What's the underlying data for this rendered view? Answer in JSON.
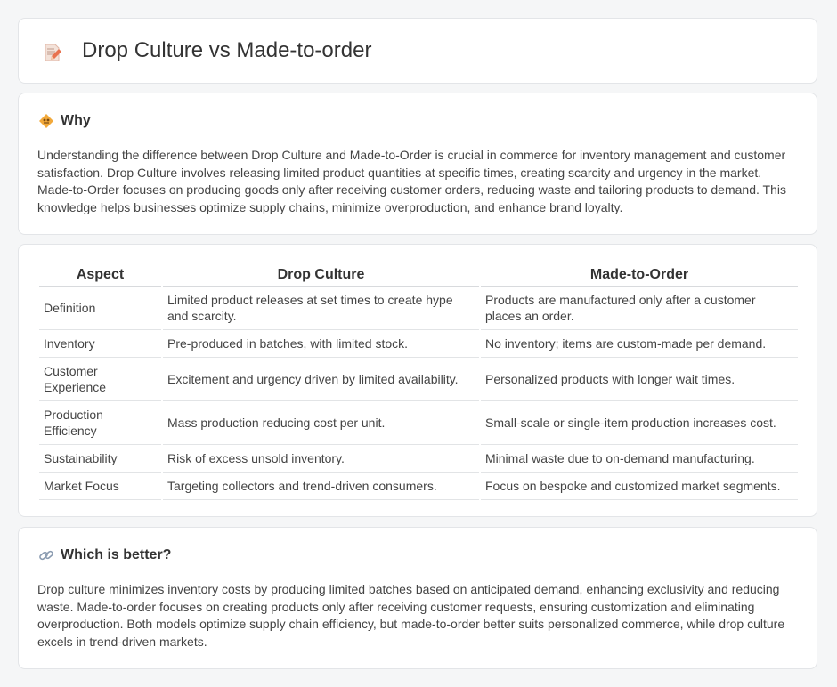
{
  "title": "Drop Culture vs Made-to-order",
  "why": {
    "heading": "Why",
    "text": "Understanding the difference between Drop Culture and Made-to-Order is crucial in commerce for inventory management and customer satisfaction. Drop Culture involves releasing limited product quantities at specific times, creating scarcity and urgency in the market. Made-to-Order focuses on producing goods only after receiving customer orders, reducing waste and tailoring products to demand. This knowledge helps businesses optimize supply chains, minimize overproduction, and enhance brand loyalty."
  },
  "table": {
    "headers": [
      "Aspect",
      "Drop Culture",
      "Made-to-Order"
    ],
    "rows": [
      [
        "Definition",
        "Limited product releases at set times to create hype and scarcity.",
        "Products are manufactured only after a customer places an order."
      ],
      [
        "Inventory",
        "Pre-produced in batches, with limited stock.",
        "No inventory; items are custom-made per demand."
      ],
      [
        "Customer Experience",
        "Excitement and urgency driven by limited availability.",
        "Personalized products with longer wait times."
      ],
      [
        "Production Efficiency",
        "Mass production reducing cost per unit.",
        "Small-scale or single-item production increases cost."
      ],
      [
        "Sustainability",
        "Risk of excess unsold inventory.",
        "Minimal waste due to on-demand manufacturing."
      ],
      [
        "Market Focus",
        "Targeting collectors and trend-driven consumers.",
        "Focus on bespoke and customized market segments."
      ]
    ]
  },
  "better": {
    "heading": "Which is better?",
    "text": "Drop culture minimizes inventory costs by producing limited batches based on anticipated demand, enhancing exclusivity and reducing waste. Made-to-order focuses on creating products only after receiving customer requests, ensuring customization and eliminating overproduction. Both models optimize supply chain efficiency, but made-to-order better suits personalized commerce, while drop culture excels in trend-driven markets."
  }
}
